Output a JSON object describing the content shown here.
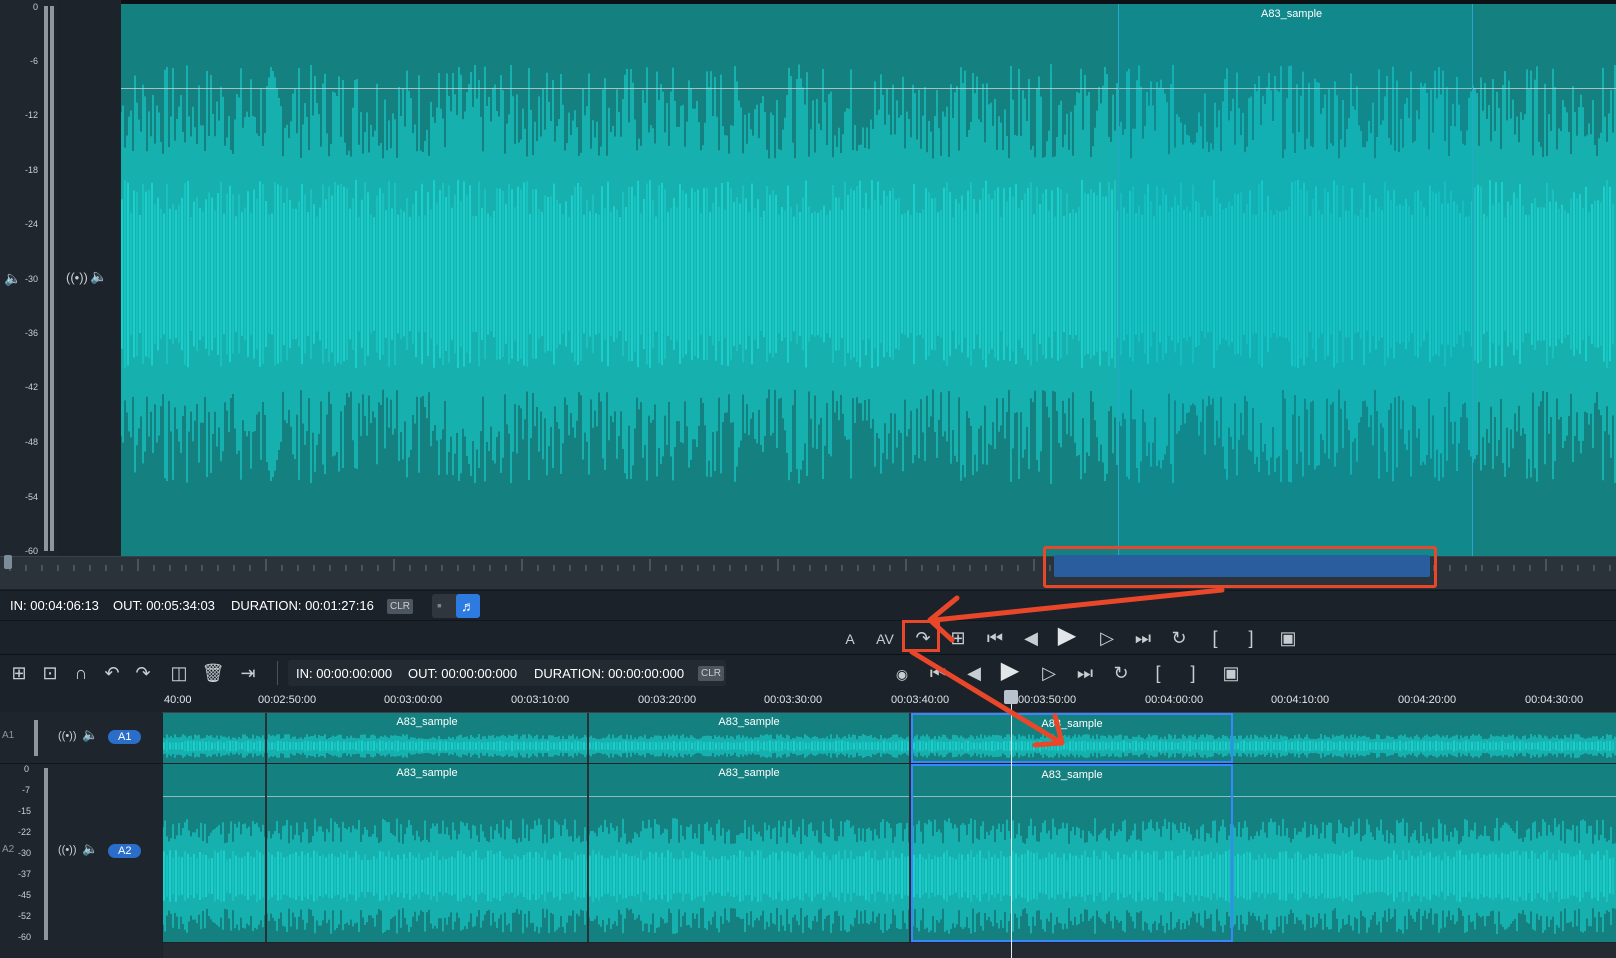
{
  "viewer": {
    "clip_name": "A83_sample",
    "db_scale": [
      "0",
      "-6",
      "-12",
      "-18",
      "-24",
      "-30",
      "-36",
      "-42",
      "-48",
      "-54",
      "-60"
    ],
    "icons": [
      "speaker-icon",
      "broadcast-icon",
      "speaker-icon"
    ]
  },
  "info_bar_top": {
    "in_label": "IN: 00:04:06:13",
    "out_label": "OUT: 00:05:34:03",
    "duration_label": "DURATION: 00:01:27:16",
    "clr_label": "CLR"
  },
  "transport_top": {
    "labels": {
      "a": "A",
      "av": "AV"
    },
    "icons": [
      "audio-only-icon",
      "audio-video-icon",
      "insert-clip-icon",
      "overwrite-clip-icon",
      "skip-start-icon",
      "step-back-icon",
      "play-icon",
      "step-forward-icon",
      "skip-end-icon",
      "loop-icon",
      "mark-in-icon",
      "mark-out-icon",
      "snapshot-icon"
    ]
  },
  "timeline_toolbar": {
    "in_label": "IN: 00:00:00:000",
    "out_label": "OUT: 00:00:00:000",
    "duration_label": "DURATION: 00:00:00:000",
    "clr_label": "CLR",
    "icons": [
      "add-track-icon",
      "trim-icon",
      "magnet-icon",
      "undo-icon",
      "redo-icon",
      "split-icon",
      "trash-icon",
      "ripple-icon"
    ]
  },
  "ruler": {
    "labels": [
      "40:00",
      "00:02:50:00",
      "00:03:00:00",
      "00:03:10:00",
      "00:03:20:00",
      "00:03:30:00",
      "00:03:40:00",
      "00:03:50:00",
      "00:04:00:00",
      "00:04:10:00",
      "00:04:20:00",
      "00:04:30:00"
    ]
  },
  "tracks": {
    "a1": {
      "side_label": "A1",
      "button": "A1"
    },
    "a2": {
      "side_label": "A2",
      "button": "A2",
      "db_scale": [
        "0",
        "-7",
        "-15",
        "-22",
        "-30",
        "-37",
        "-45",
        "-52",
        "-60"
      ]
    },
    "clip_name": "A83_sample"
  },
  "colors": {
    "waveform_bg": "#14807f",
    "waveform_peak": "#19d3cf",
    "accent": "#2a6ec9",
    "annotation": "#e9472a"
  }
}
